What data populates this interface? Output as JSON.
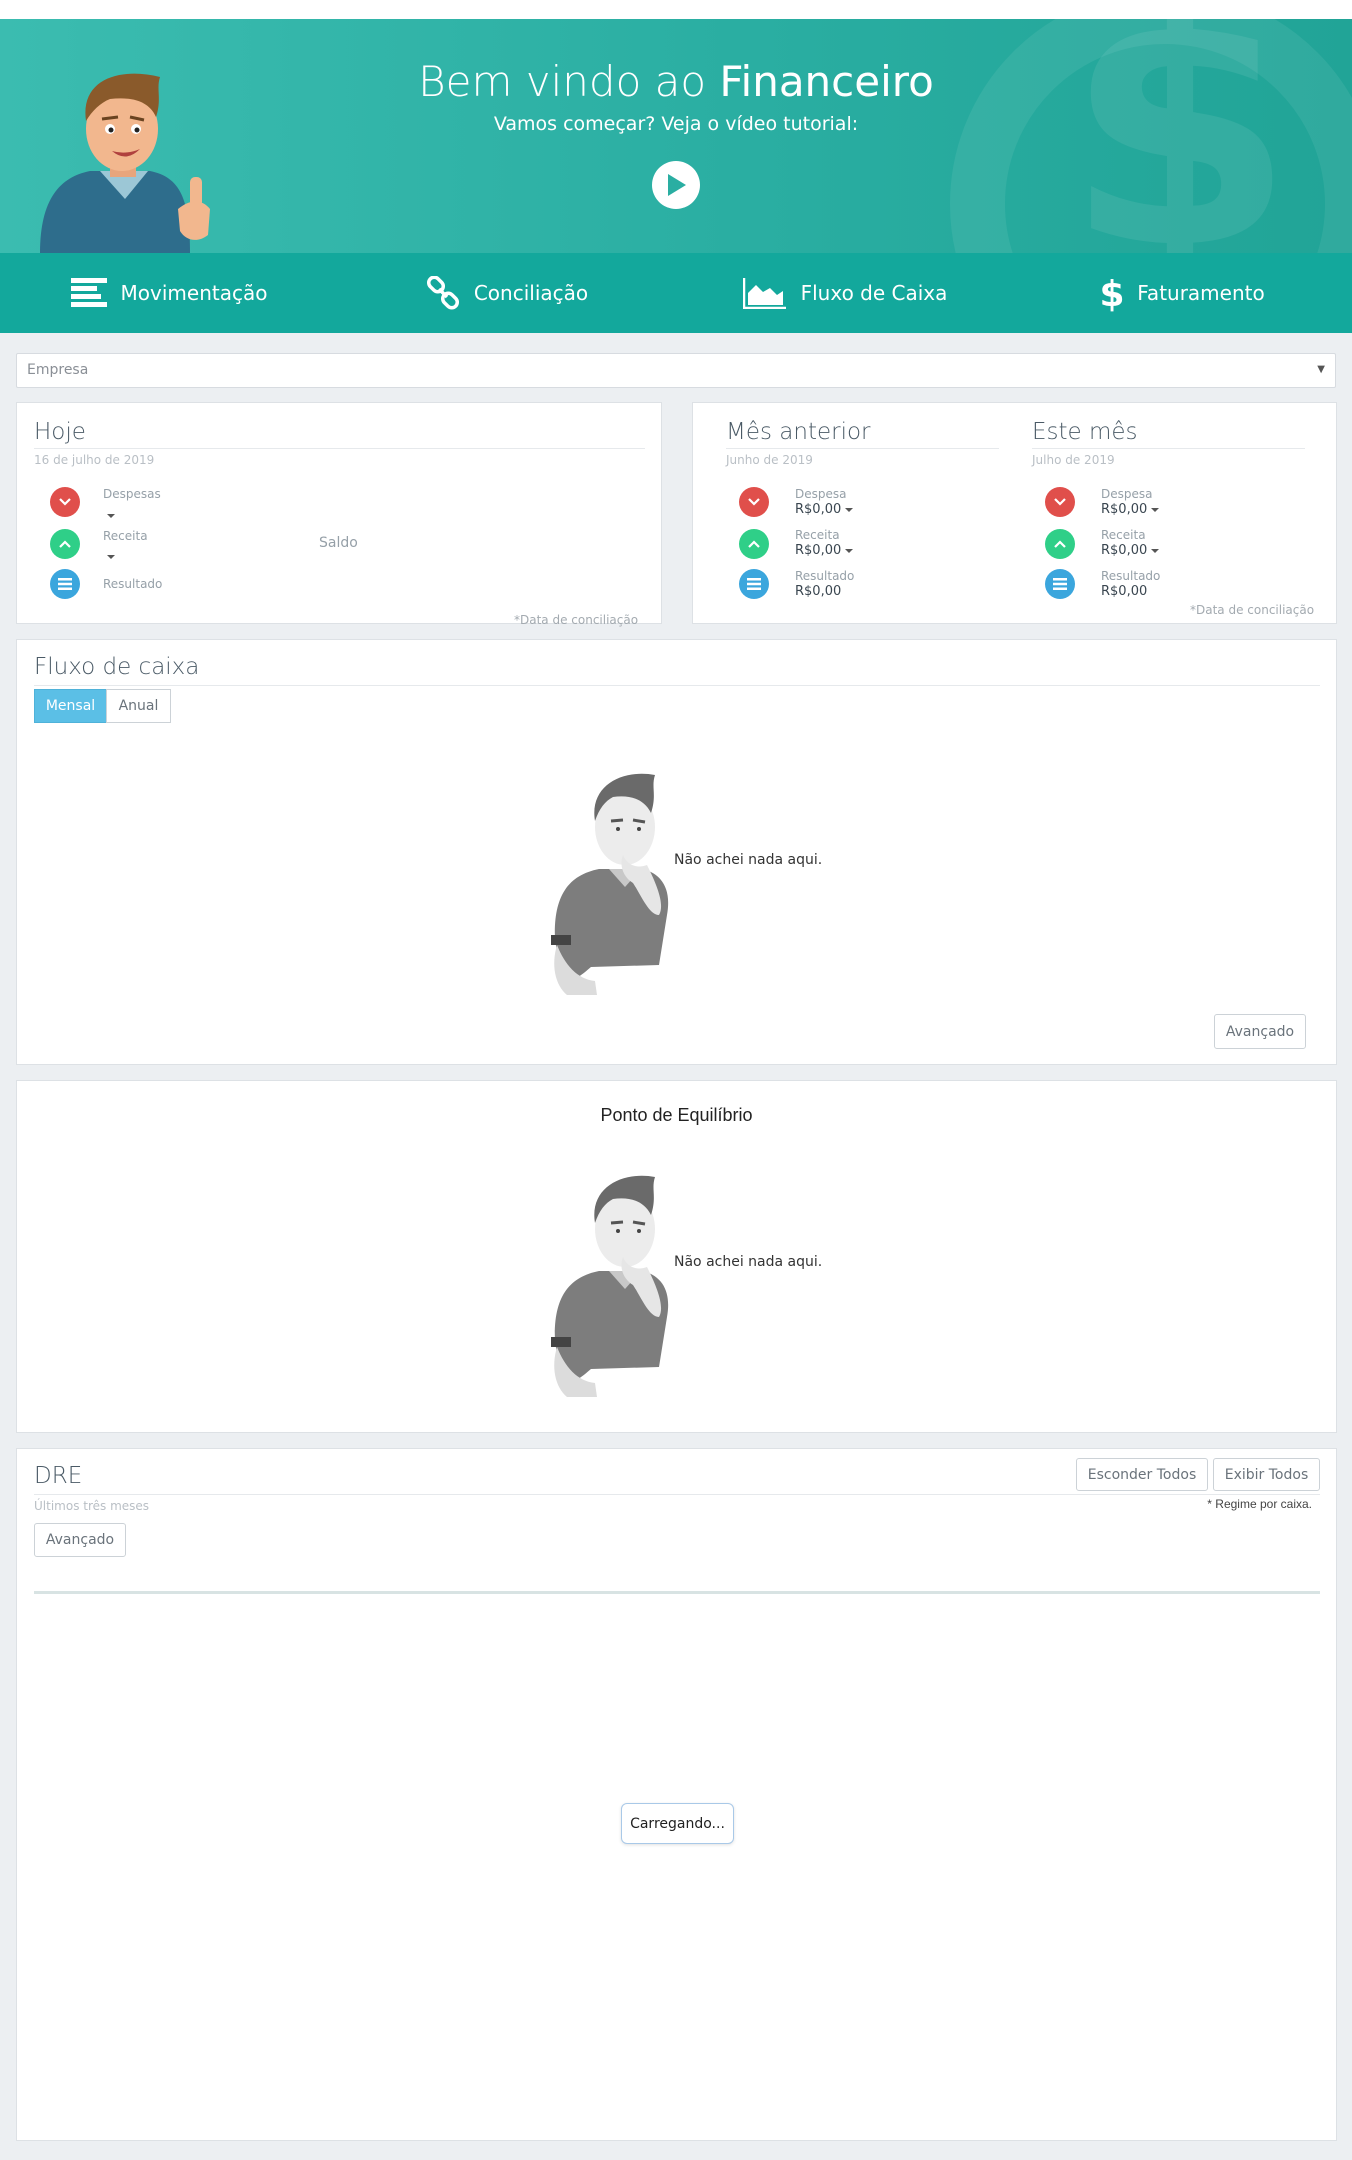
{
  "hero": {
    "title_prefix": "Bem vindo ao ",
    "title_brand": "Financeiro",
    "subtitle": "Vamos começar? Veja o vídeo tutorial:",
    "play_icon": "play-circle-icon"
  },
  "nav": [
    {
      "label": "Movimentação",
      "icon": "list-lines-icon"
    },
    {
      "label": "Conciliação",
      "icon": "link-chain-icon"
    },
    {
      "label": "Fluxo de Caixa",
      "icon": "area-chart-icon"
    },
    {
      "label": "Faturamento",
      "icon": "dollar-icon"
    }
  ],
  "empresa": {
    "placeholder": "Empresa"
  },
  "hoje": {
    "title": "Hoje",
    "date": "16 de julho de 2019",
    "despesas_label": "Despesas",
    "receita_label": "Receita",
    "resultado_label": "Resultado",
    "saldo_label": "Saldo",
    "note": "*Data de conciliação"
  },
  "mes_anterior": {
    "title": "Mês anterior",
    "date": "Junho de 2019",
    "despesa_label": "Despesa",
    "despesa_value": "R$0,00",
    "receita_label": "Receita",
    "receita_value": "R$0,00",
    "resultado_label": "Resultado",
    "resultado_value": "R$0,00"
  },
  "este_mes": {
    "title": "Este mês",
    "date": "Julho de 2019",
    "despesa_label": "Despesa",
    "despesa_value": "R$0,00",
    "receita_label": "Receita",
    "receita_value": "R$0,00",
    "resultado_label": "Resultado",
    "resultado_value": "R$0,00",
    "note": "*Data de conciliação"
  },
  "fluxo": {
    "title": "Fluxo de caixa",
    "tab_mensal": "Mensal",
    "tab_anual": "Anual",
    "empty_text": "Não achei nada aqui.",
    "advanced_button": "Avançado"
  },
  "ponto": {
    "title": "Ponto de Equilíbrio",
    "empty_text": "Não achei nada aqui."
  },
  "dre": {
    "title": "DRE",
    "subtitle": "Últimos três meses",
    "hide_all": "Esconder Todos",
    "show_all": "Exibir Todos",
    "regime": "* Regime por caixa.",
    "advanced_button": "Avançado",
    "loading": "Carregando..."
  },
  "colors": {
    "hero": "#2aaea2",
    "nav": "#13a89c",
    "expense": "#e04f4b",
    "income": "#2fcf88",
    "result": "#3ba6dd",
    "active_tab": "#5bbfe6"
  }
}
